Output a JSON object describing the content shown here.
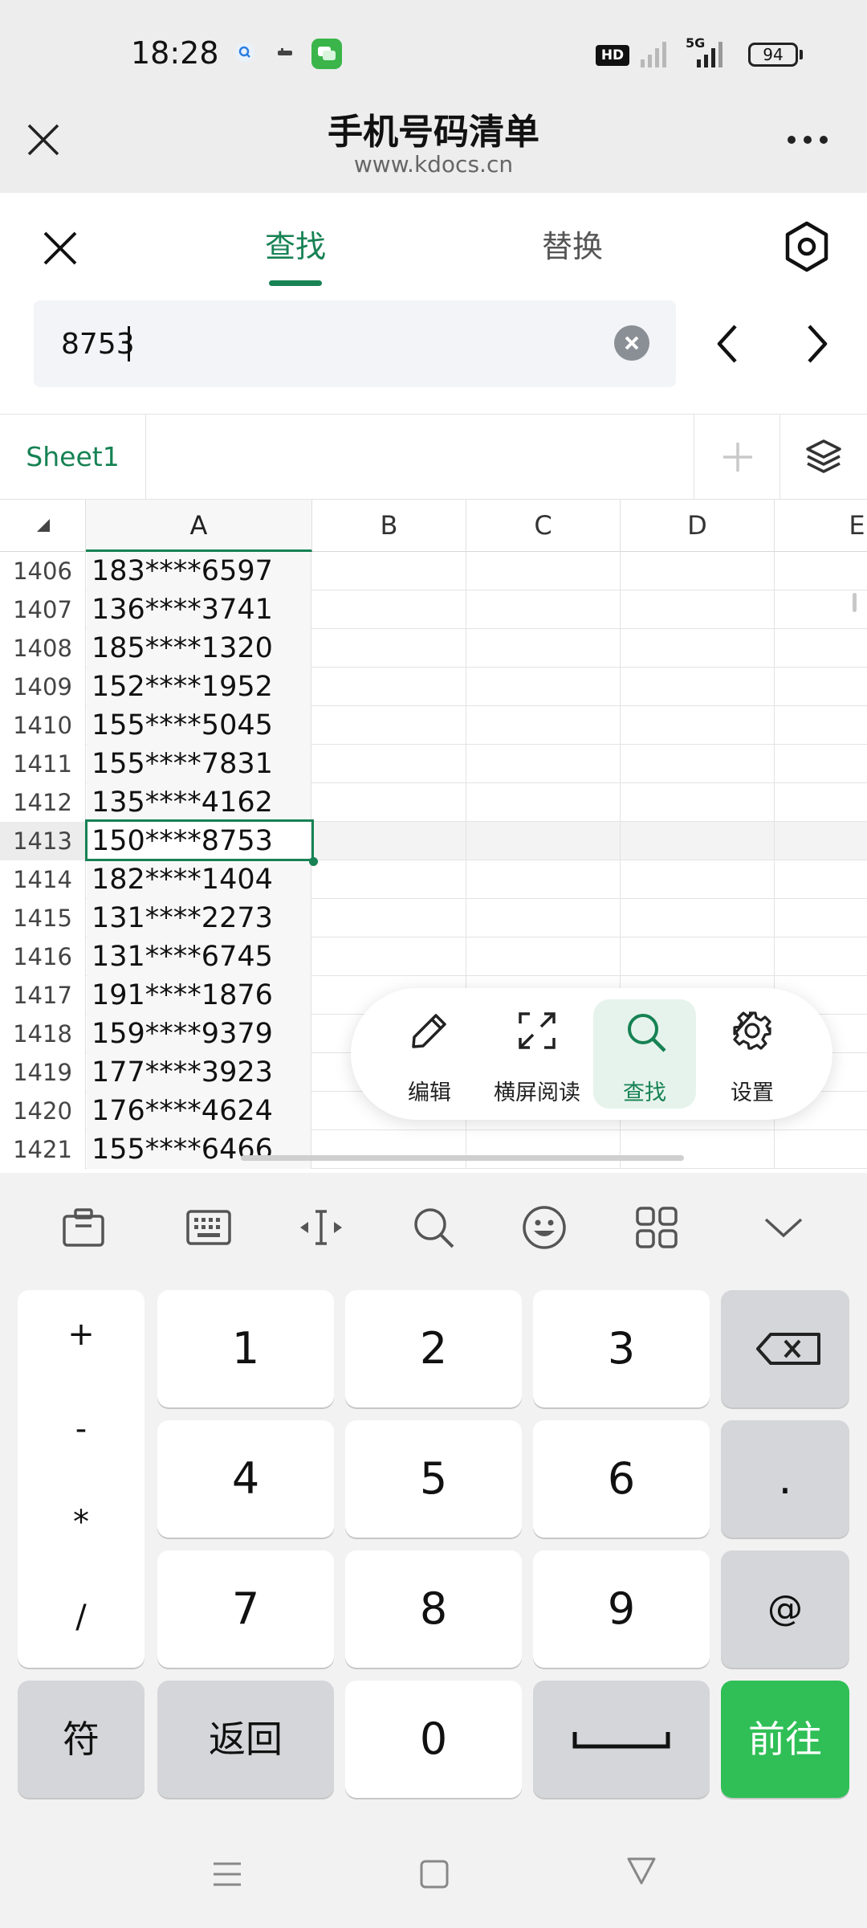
{
  "status_bar": {
    "time": "18:28",
    "battery": "94",
    "network": "5G",
    "hd": "HD"
  },
  "title_bar": {
    "title": "手机号码清单",
    "url": "www.kdocs.cn"
  },
  "find_panel": {
    "tabs": [
      {
        "label": "查找",
        "active": true
      },
      {
        "label": "替换",
        "active": false
      }
    ],
    "search_value": "8753"
  },
  "sheet_tabs": {
    "active": "Sheet1"
  },
  "grid": {
    "columns": [
      "A",
      "B",
      "C",
      "D",
      "E"
    ],
    "rows": [
      {
        "num": "1406",
        "a": "183****6597"
      },
      {
        "num": "1407",
        "a": "136****3741"
      },
      {
        "num": "1408",
        "a": "185****1320"
      },
      {
        "num": "1409",
        "a": "152****1952"
      },
      {
        "num": "1410",
        "a": "155****5045"
      },
      {
        "num": "1411",
        "a": "155****7831"
      },
      {
        "num": "1412",
        "a": "135****4162"
      },
      {
        "num": "1413",
        "a": "150****8753",
        "selected": true
      },
      {
        "num": "1414",
        "a": "182****1404"
      },
      {
        "num": "1415",
        "a": "131****2273"
      },
      {
        "num": "1416",
        "a": "131****6745"
      },
      {
        "num": "1417",
        "a": "191****1876"
      },
      {
        "num": "1418",
        "a": "159****9379"
      },
      {
        "num": "1419",
        "a": "177****3923"
      },
      {
        "num": "1420",
        "a": "176****4624"
      },
      {
        "num": "1421",
        "a": "155****6466"
      }
    ]
  },
  "floating_toolbar": [
    {
      "label": "编辑",
      "icon": "pencil-icon"
    },
    {
      "label": "横屏阅读",
      "icon": "expand-icon"
    },
    {
      "label": "查找",
      "icon": "search-icon",
      "active": true
    },
    {
      "label": "设置",
      "icon": "gear-icon"
    }
  ],
  "keyboard": {
    "symbols": [
      "+",
      "-",
      "*",
      "/"
    ],
    "digits": [
      "1",
      "2",
      "3",
      "4",
      "5",
      "6",
      "7",
      "8",
      "9",
      "0"
    ],
    "dot": ".",
    "at": "@",
    "symbol_key": "符",
    "back_key": "返回",
    "go_key": "前往"
  },
  "colors": {
    "accent": "#178254",
    "go_key": "#2fbf56"
  }
}
